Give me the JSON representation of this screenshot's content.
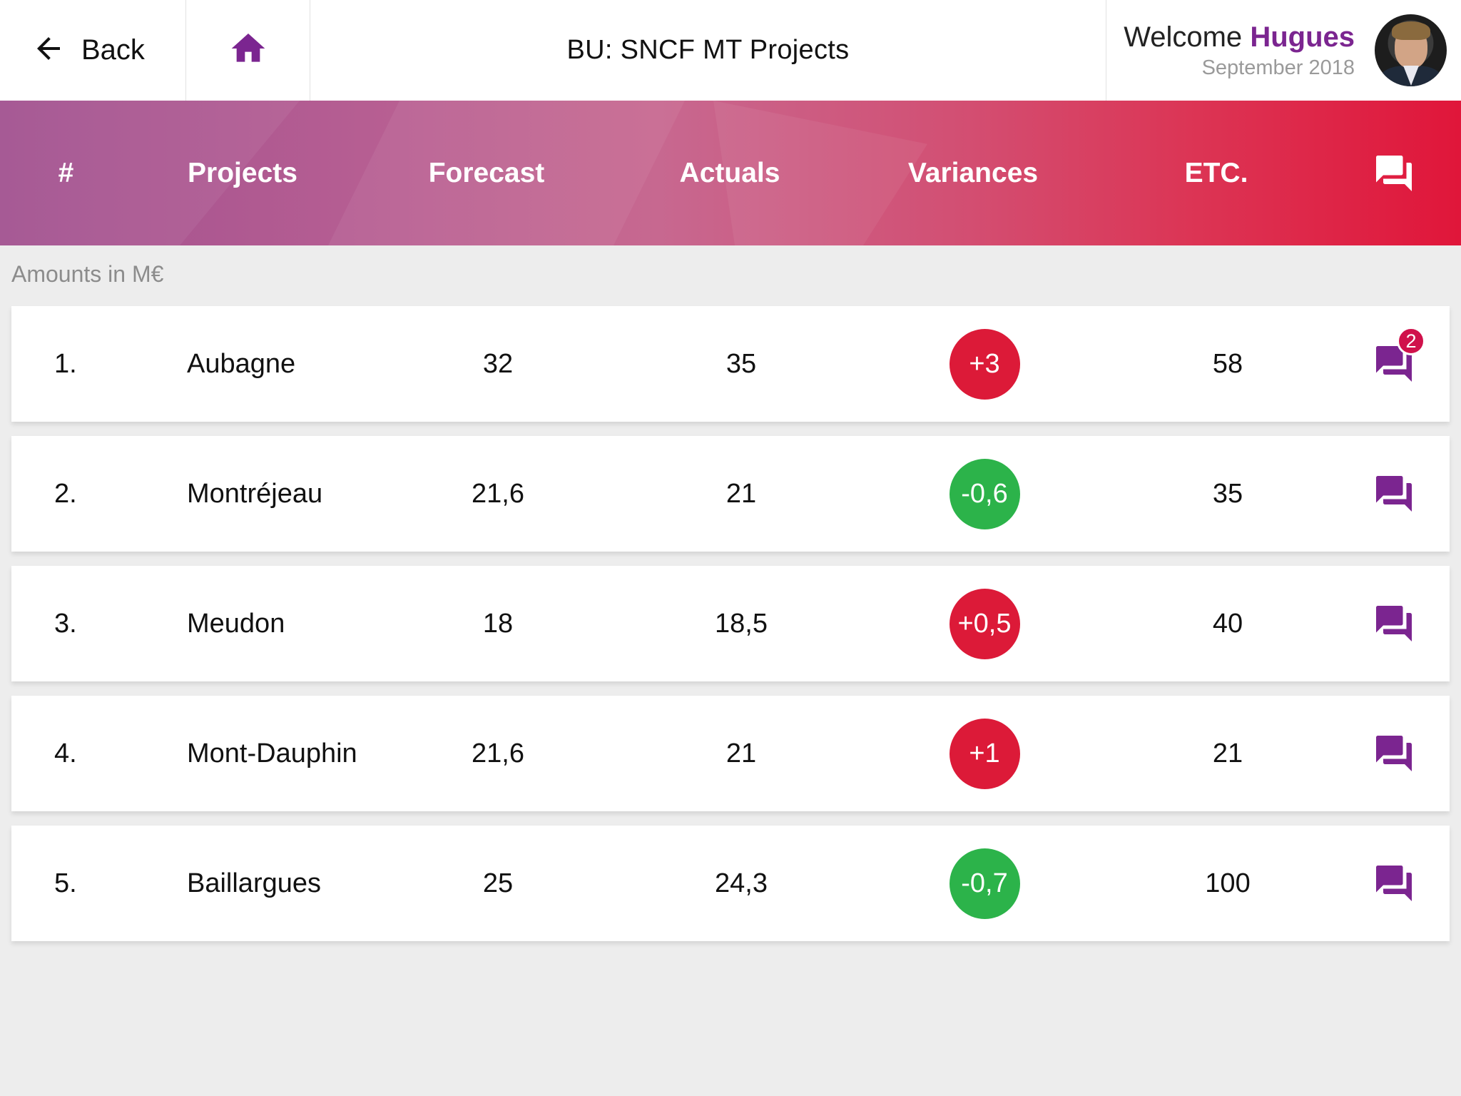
{
  "topbar": {
    "back_label": "Back",
    "title": "BU: SNCF MT Projects",
    "welcome_prefix": "Welcome",
    "user_name": "Hugues",
    "period": "September 2018"
  },
  "table": {
    "headers": [
      "#",
      "Projects",
      "Forecast",
      "Actuals",
      "Variances",
      "ETC."
    ],
    "note": "Amounts in M€",
    "rows": [
      {
        "num": "1.",
        "project": "Aubagne",
        "forecast": "32",
        "actuals": "35",
        "variance": "+3",
        "variance_status": "negative",
        "etc": "58",
        "comments_count": "2"
      },
      {
        "num": "2.",
        "project": "Montréjeau",
        "forecast": "21,6",
        "actuals": "21",
        "variance": "-0,6",
        "variance_status": "positive",
        "etc": "35",
        "comments_count": ""
      },
      {
        "num": "3.",
        "project": "Meudon",
        "forecast": "18",
        "actuals": "18,5",
        "variance": "+0,5",
        "variance_status": "negative",
        "etc": "40",
        "comments_count": ""
      },
      {
        "num": "4.",
        "project": "Mont-Dauphin",
        "forecast": "21,6",
        "actuals": "21",
        "variance": "+1",
        "variance_status": "negative",
        "etc": "21",
        "comments_count": ""
      },
      {
        "num": "5.",
        "project": "Baillargues",
        "forecast": "25",
        "actuals": "24,3",
        "variance": "-0,7",
        "variance_status": "positive",
        "etc": "100",
        "comments_count": ""
      }
    ]
  },
  "colors": {
    "accent": "#7b2590",
    "variance_over": "#dc1a38",
    "variance_under": "#2cb34a",
    "gradient_start": "#a1508f",
    "gradient_end": "#e0163a"
  },
  "icons": {
    "back": "arrow-left-icon",
    "home": "home-icon",
    "comments": "comments-icon"
  }
}
